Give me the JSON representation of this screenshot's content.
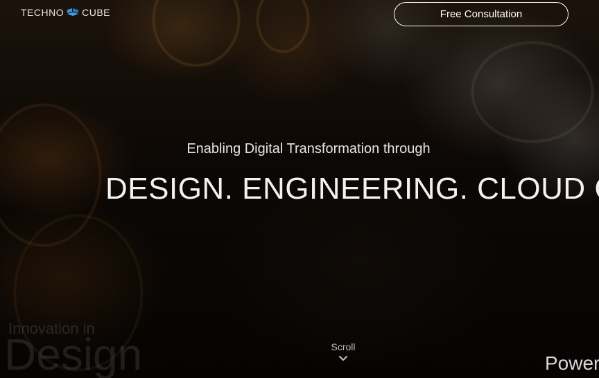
{
  "header": {
    "logo_left": "TECHNO",
    "logo_right": "CUBE",
    "logo_icon": "cube-flag-icon",
    "cta_label": "Free Consultation"
  },
  "hero": {
    "subtitle": "Enabling Digital Transformation through",
    "headline": "DESIGN. ENGINEERING. CLOUD CO"
  },
  "background_text": {
    "small": "Innovation in",
    "large": "Design",
    "right": "Power"
  },
  "scroll": {
    "label": "Scroll",
    "icon": "chevron-down-icon"
  },
  "colors": {
    "accent": "#2f7fd6",
    "text": "#ffffff"
  }
}
